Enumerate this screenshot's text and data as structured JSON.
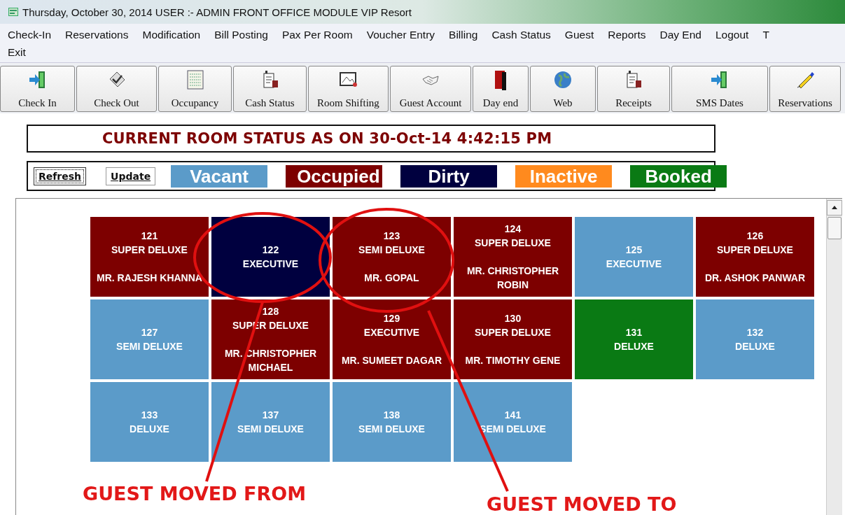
{
  "window": {
    "title": "Thursday, October 30, 2014   USER :- ADMIN FRONT OFFICE MODULE   VIP Resort"
  },
  "menu": {
    "rows": [
      [
        "Check-In",
        "Reservations",
        "Modification",
        "Bill Posting",
        "Pax Per Room",
        "Voucher Entry",
        "Billing",
        "Cash Status",
        "Guest",
        "Reports",
        "Day End",
        "Logout",
        "T"
      ],
      [
        "Exit"
      ]
    ]
  },
  "toolbar": [
    "Check In",
    "Check Out",
    "Occupancy",
    "Cash Status",
    "Room Shifting",
    "Guest Account",
    "Day end",
    "Web",
    "Receipts",
    "SMS Dates",
    "Reservations"
  ],
  "status_header": "CURRENT ROOM STATUS AS ON 30-Oct-14 4:42:15 PM",
  "buttons": [
    "Refresh",
    "Update"
  ],
  "legend": [
    {
      "label": "Vacant",
      "color": "#5b9bc9"
    },
    {
      "label": "Occupied",
      "color": "#7d0000"
    },
    {
      "label": "Dirty",
      "color": "#00003f"
    },
    {
      "label": "Inactive",
      "color": "#ff8a1e"
    },
    {
      "label": "Booked",
      "color": "#0a7a14"
    }
  ],
  "rooms": [
    {
      "number": "121",
      "type": "SUPER DELUXE",
      "guest": "MR. RAJESH KHANNA",
      "color": "#7d0000"
    },
    {
      "number": "122",
      "type": "EXECUTIVE",
      "color": "#00003f"
    },
    {
      "number": "123",
      "type": "SEMI DELUXE",
      "guest": "MR. GOPAL",
      "color": "#7d0000"
    },
    {
      "number": "124",
      "type": "SUPER DELUXE",
      "guest": "MR. CHRISTOPHER ROBIN",
      "color": "#7d0000"
    },
    {
      "number": "125",
      "type": "EXECUTIVE",
      "color": "#5b9bc9"
    },
    {
      "number": "126",
      "type": "SUPER DELUXE",
      "guest": "DR. ASHOK PANWAR",
      "color": "#7d0000"
    },
    {
      "number": "127",
      "type": "SEMI DELUXE",
      "color": "#5b9bc9"
    },
    {
      "number": "128",
      "type": "SUPER DELUXE",
      "guest": "MR. CHRISTOPHER MICHAEL",
      "color": "#7d0000"
    },
    {
      "number": "129",
      "type": "EXECUTIVE",
      "guest": "MR. SUMEET DAGAR",
      "color": "#7d0000"
    },
    {
      "number": "130",
      "type": "SUPER DELUXE",
      "guest": "MR. TIMOTHY GENE",
      "color": "#7d0000"
    },
    {
      "number": "131",
      "type": "DELUXE",
      "color": "#0a7a14"
    },
    {
      "number": "132",
      "type": "DELUXE",
      "color": "#5b9bc9"
    },
    {
      "number": "133",
      "type": "DELUXE",
      "color": "#5b9bc9"
    },
    {
      "number": "137",
      "type": "SEMI DELUXE",
      "color": "#5b9bc9"
    },
    {
      "number": "138",
      "type": "SEMI DELUXE",
      "color": "#5b9bc9"
    },
    {
      "number": "141",
      "type": "SEMI DELUXE",
      "color": "#5b9bc9"
    }
  ],
  "annotations": [
    "GUEST MOVED FROM",
    "GUEST MOVED TO"
  ]
}
